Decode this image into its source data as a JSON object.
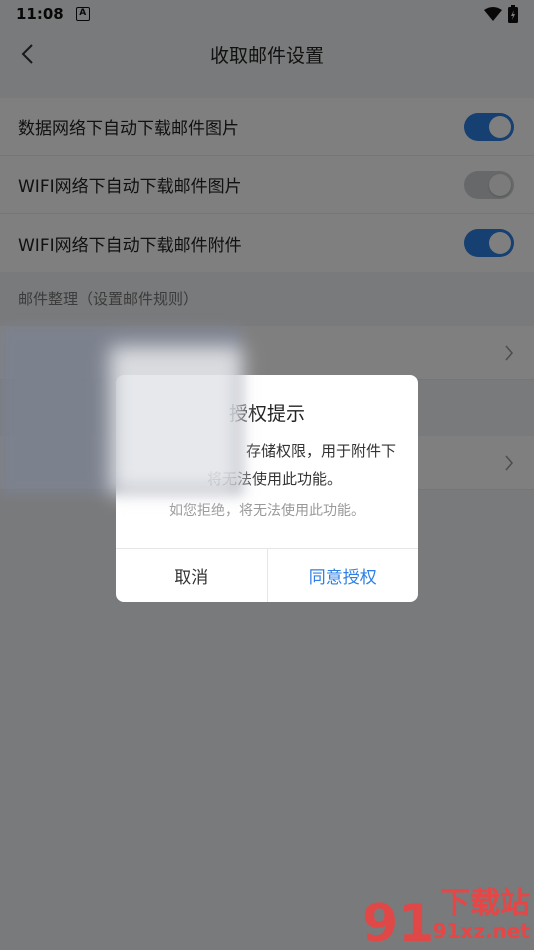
{
  "status_bar": {
    "time": "11:08",
    "notification_icon": "A"
  },
  "header": {
    "title": "收取邮件设置"
  },
  "settings": [
    {
      "label": "数据网络下自动下载邮件图片",
      "enabled": true
    },
    {
      "label": "WIFI网络下自动下载邮件图片",
      "enabled": false
    },
    {
      "label": "WIFI网络下自动下载邮件附件",
      "enabled": true
    }
  ],
  "section_header": "邮件整理（设置邮件规则）",
  "dialog": {
    "title_visible": "授权提示",
    "message_line1": "存储权限，用于附件下",
    "message_line2": "将无法使用此功能。",
    "note": "如您拒绝，将无法使用此功能。",
    "cancel": "取消",
    "agree": "同意授权"
  },
  "watermark": {
    "logo": "91",
    "cn": "下载站",
    "domain": "91xz.net"
  },
  "colors": {
    "accent": "#2d7fe5",
    "watermark": "#e64646"
  }
}
